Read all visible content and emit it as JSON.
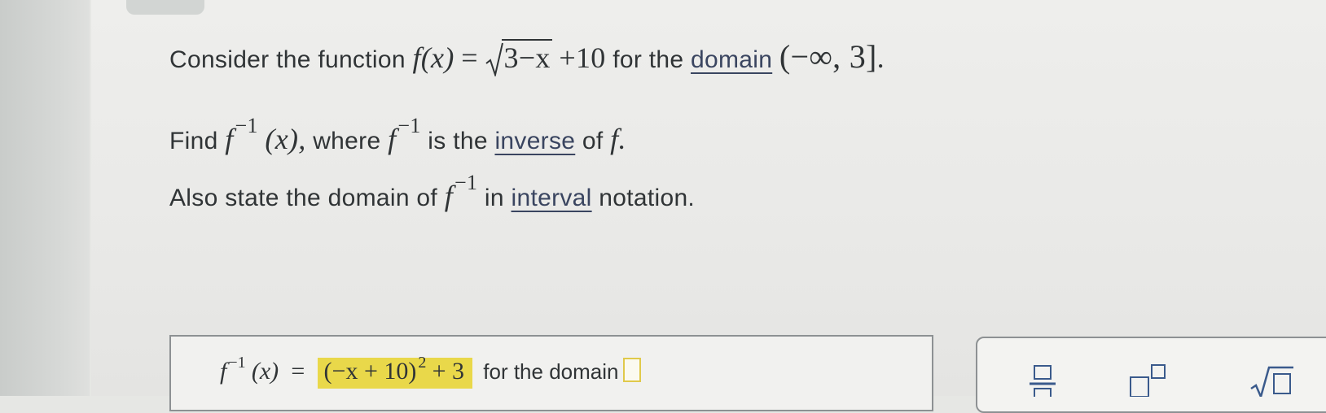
{
  "question": {
    "line1": {
      "prefix": "Consider the function",
      "f": "f",
      "arg": "(x)",
      "eq": "=",
      "radicand": "3−x",
      "plus_const": "+10",
      "for_the": "for the",
      "domain_link": "domain",
      "interval": "(−∞, 3]",
      "period": "."
    },
    "line2": {
      "prefix": "Find",
      "f": "f",
      "inv": "−1",
      "arg": "(x),",
      "where": "where",
      "f2": "f",
      "inv2": "−1",
      "is_the": "is the",
      "inverse_link": "inverse",
      "of": "of",
      "f3": "f."
    },
    "line3": {
      "prefix": "Also state the domain of",
      "f": "f",
      "inv": "−1",
      "in": "in",
      "interval_link": "interval",
      "suffix": "notation."
    }
  },
  "answer": {
    "f": "f",
    "inv": "−1",
    "arg": "(x)",
    "eq": "=",
    "expr_base": "(−x + 10)",
    "expr_exp": "2",
    "expr_tail": "+ 3",
    "for_domain": "for the domain",
    "domain_value": ""
  },
  "toolbar": {
    "tools": [
      "fraction-icon",
      "superscript-icon",
      "sqrt-icon"
    ]
  },
  "colors": {
    "highlight": "#e9d84a",
    "link": "#3a4560",
    "text": "#303436"
  }
}
